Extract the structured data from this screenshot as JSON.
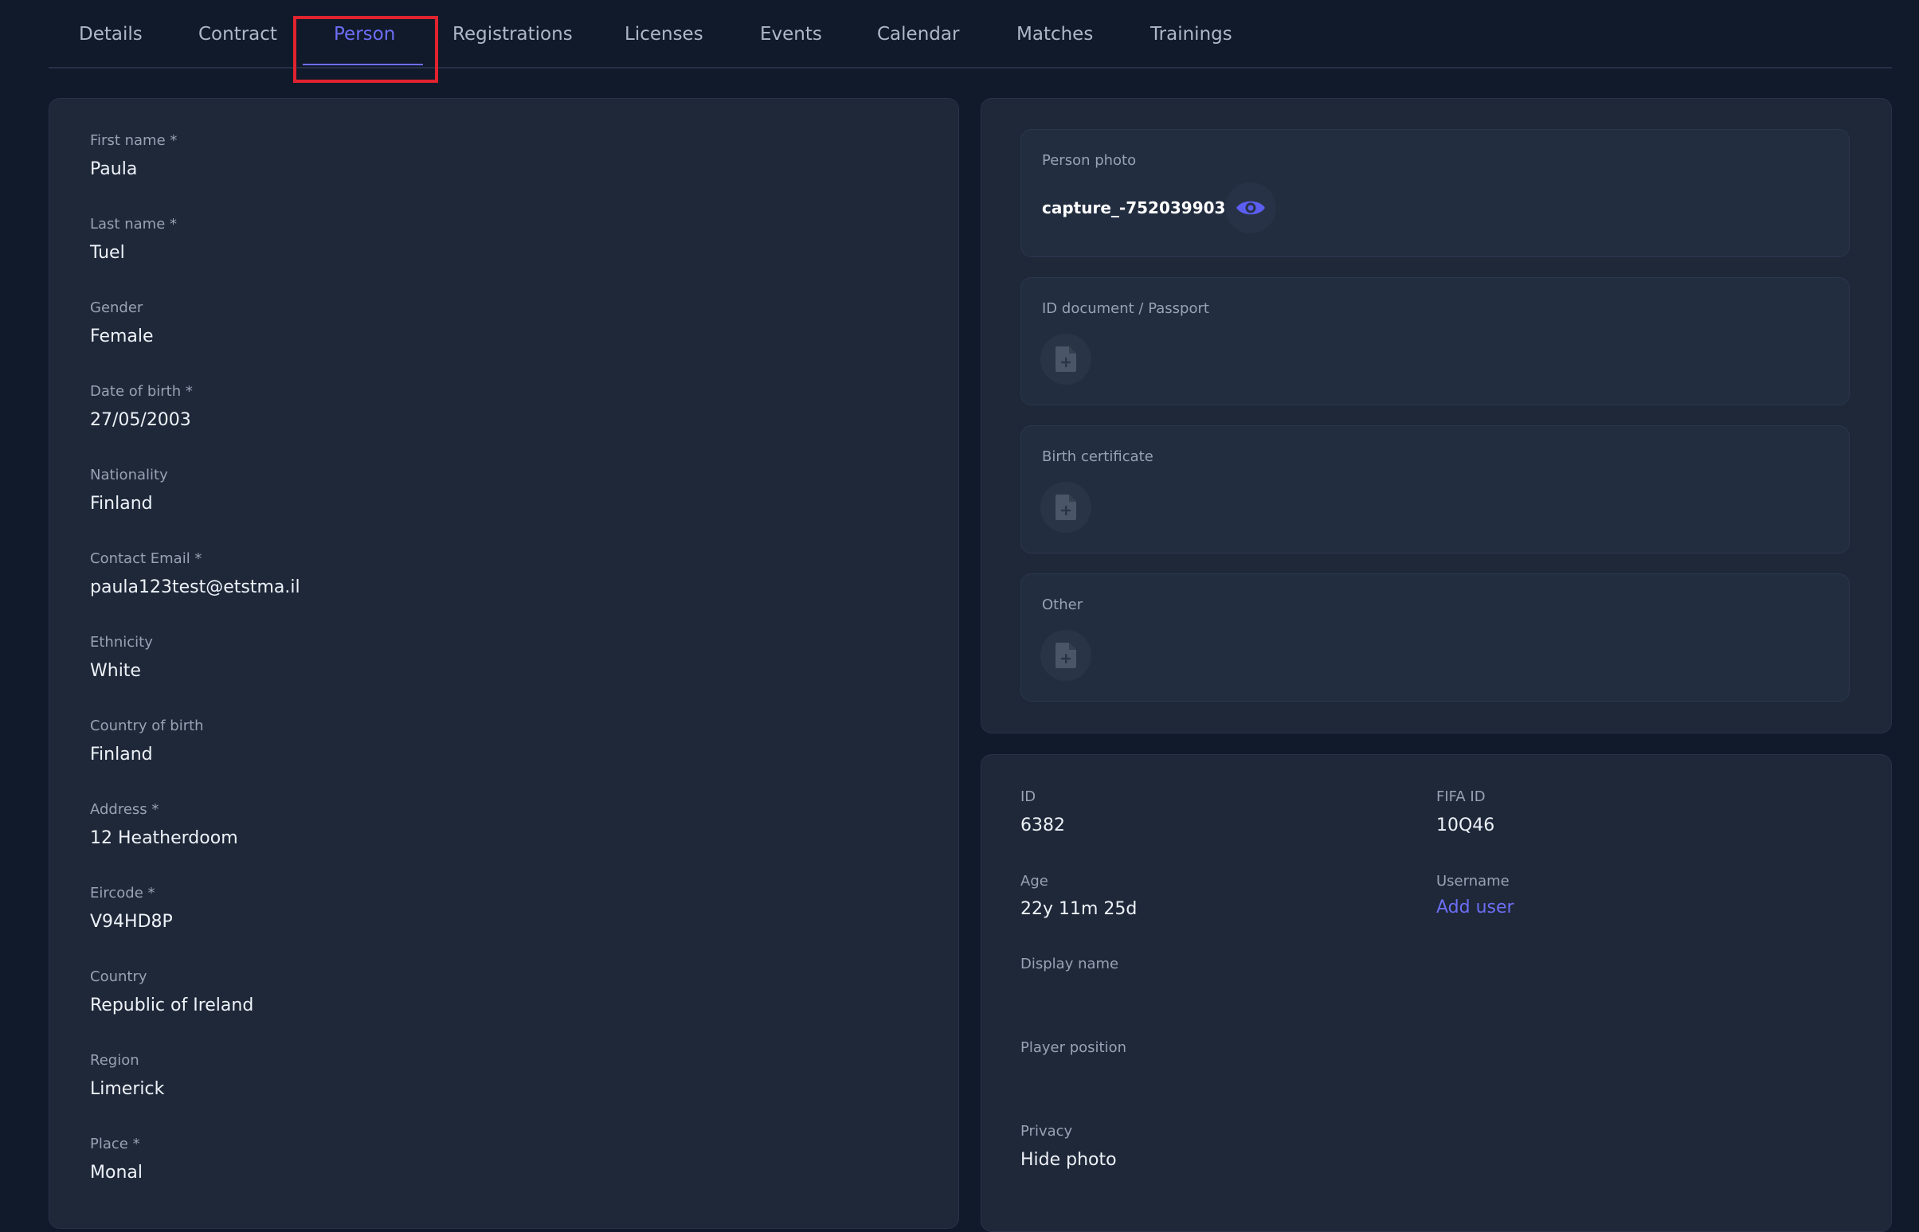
{
  "tabs": [
    {
      "label": "Details"
    },
    {
      "label": "Contract"
    },
    {
      "label": "Person"
    },
    {
      "label": "Registrations"
    },
    {
      "label": "Licenses"
    },
    {
      "label": "Events"
    },
    {
      "label": "Calendar"
    },
    {
      "label": "Matches"
    },
    {
      "label": "Trainings"
    }
  ],
  "active_tab": "Person",
  "person": {
    "first_name": {
      "label": "First name *",
      "value": "Paula"
    },
    "last_name": {
      "label": "Last name *",
      "value": "Tuel"
    },
    "gender": {
      "label": "Gender",
      "value": "Female"
    },
    "dob": {
      "label": "Date of birth *",
      "value": "27/05/2003"
    },
    "nationality": {
      "label": "Nationality",
      "value": "Finland"
    },
    "email": {
      "label": "Contact Email *",
      "value": "paula123test@etstma.il"
    },
    "ethnicity": {
      "label": "Ethnicity",
      "value": "White"
    },
    "country_of_birth": {
      "label": "Country of birth",
      "value": "Finland"
    },
    "address": {
      "label": "Address *",
      "value": "12 Heatherdoom"
    },
    "eircode": {
      "label": "Eircode *",
      "value": "V94HD8P"
    },
    "country": {
      "label": "Country",
      "value": "Republic of Ireland"
    },
    "region": {
      "label": "Region",
      "value": "Limerick"
    },
    "place": {
      "label": "Place *",
      "value": "Monal"
    }
  },
  "documents": {
    "photo": {
      "label": "Person photo",
      "file": "capture_-752039903.png"
    },
    "id_document": {
      "label": "ID document / Passport"
    },
    "birth_certificate": {
      "label": "Birth certificate"
    },
    "other": {
      "label": "Other"
    }
  },
  "info": {
    "id": {
      "label": "ID",
      "value": "6382"
    },
    "fifa_id": {
      "label": "FIFA ID",
      "value": "10Q46"
    },
    "age": {
      "label": "Age",
      "value": "22y 11m 25d"
    },
    "username": {
      "label": "Username",
      "link": "Add user"
    },
    "display_name": {
      "label": "Display name",
      "value": ""
    },
    "player_position": {
      "label": "Player position",
      "value": ""
    },
    "privacy": {
      "label": "Privacy",
      "value": "Hide photo"
    }
  },
  "colors": {
    "background": "#111a2b",
    "card": "#1e2839",
    "accent": "#6d6ef5",
    "highlight": "#e0232e"
  }
}
